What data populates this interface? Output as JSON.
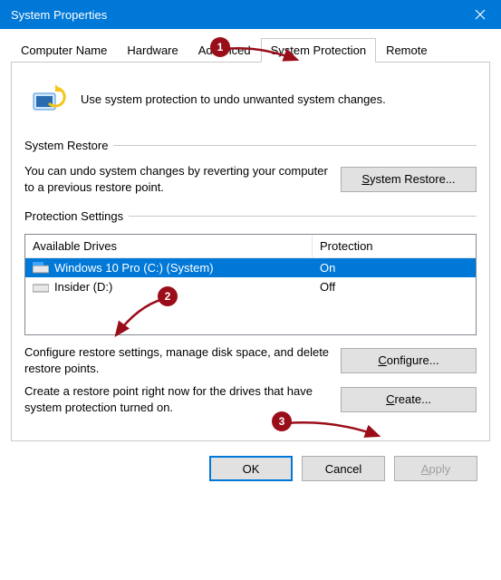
{
  "window": {
    "title": "System Properties"
  },
  "tabs": {
    "items": [
      {
        "label": "Computer Name"
      },
      {
        "label": "Hardware"
      },
      {
        "label": "Advanced"
      },
      {
        "label": "System Protection"
      },
      {
        "label": "Remote"
      }
    ],
    "active_index": 3
  },
  "intro": {
    "text": "Use system protection to undo unwanted system changes."
  },
  "restore_group": {
    "title": "System Restore",
    "desc": "You can undo system changes by reverting your computer to a previous restore point.",
    "button_prefix": "S",
    "button_suffix": "ystem Restore..."
  },
  "protection_group": {
    "title": "Protection Settings",
    "col_drives": "Available Drives",
    "col_protection": "Protection",
    "drives": [
      {
        "name": "Windows 10 Pro (C:) (System)",
        "status": "On",
        "selected": true,
        "icon": "drive-system"
      },
      {
        "name": "Insider (D:)",
        "status": "Off",
        "selected": false,
        "icon": "drive"
      }
    ],
    "configure_desc": "Configure restore settings, manage disk space, and delete restore points.",
    "configure_prefix": "C",
    "configure_suffix": "onfigure...",
    "create_desc": "Create a restore point right now for the drives that have system protection turned on.",
    "create_prefix": "C",
    "create_suffix": "reate..."
  },
  "footer": {
    "ok": "OK",
    "cancel": "Cancel",
    "apply_prefix": "A",
    "apply_suffix": "pply"
  },
  "annotations": {
    "b1": "1",
    "b2": "2",
    "b3": "3"
  }
}
